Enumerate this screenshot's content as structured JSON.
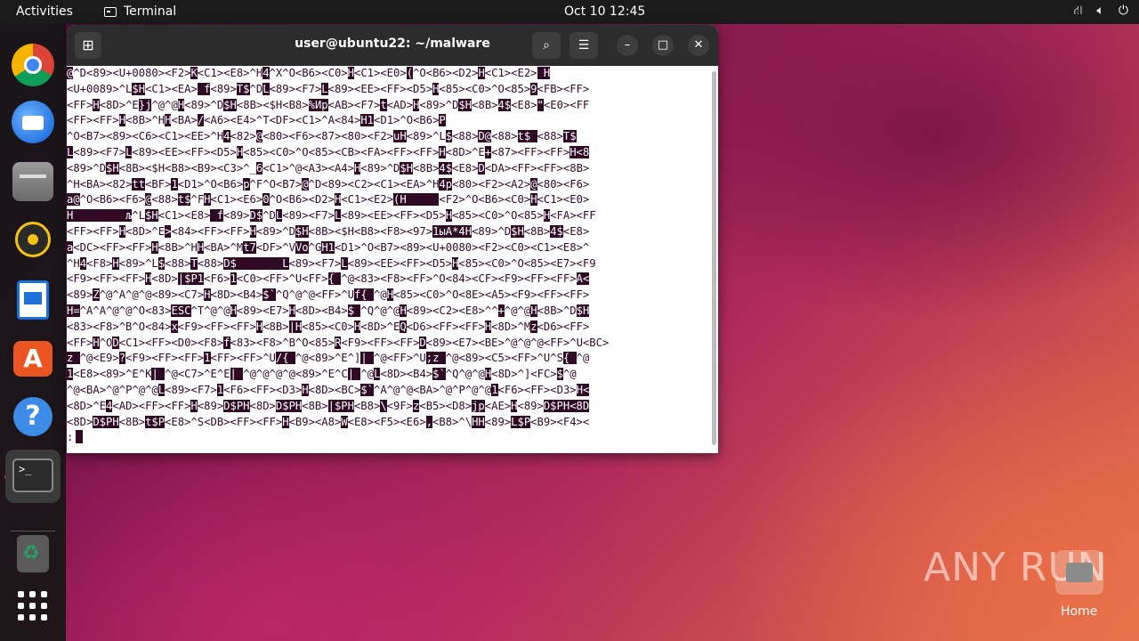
{
  "topbar": {
    "activities": "Activities",
    "task": "Terminal",
    "clock": "Oct 10  12:45",
    "tray": [
      "network-icon",
      "volume-icon",
      "power-icon"
    ]
  },
  "dock": {
    "items": [
      "chrome-icon",
      "thunderbird-icon",
      "files-icon",
      "rhythmbox-icon",
      "writer-icon",
      "app-center-icon",
      "help-icon",
      "terminal-icon",
      "trash-icon",
      "show-apps-icon"
    ],
    "terminal_glyph": ">_"
  },
  "window": {
    "title": "user@ubuntu22: ~/malware"
  },
  "terminal": {
    "lines": [
      "@^D<89><U+0080><F2>K<C1><E8>^H4^X^O<B6><C0>H<C1><E0>(^O<B6><D2>H<C1><E2> H",
      "<U+0089>^L$H<C1><EA> f<89>T$^DL<89><F7>L<89><EE><FF><D5>H<85><C0>^O<85>9<FB><FF>",
      "<FF>H<8D>^E}j^@^@H<89>^D$H<8B><$H<B8>%Иp<AB><F7>t<AD>H<89>^D$H<8B>4$<E8>\"<E0><FF",
      "<FF><FF>H<8B>^HH<BA>/<A6><E4>^T<DF><C1>^A<84>H1<D1>^O<B6>P",
      "^O<B7><89><C6><C1><EE>^H4<82>@<80><F6><87><80><F2>uH<89>^L$<88>D@<88>t$ <88>T$",
      "L<89><F7>L<89><EE><FF><D5>H<85><C0>^O<85><CB><FA><FF><FF>H<8D>^E+<87><FF><FF>H<8",
      "<89>^D$H<8B><$H<B8><B9><C3>^_6<C1>^@<A3><A4>H<89>^D$H<8B>4$<E8>D<DA><FF><FF><8B>",
      "^H<BA><82>tt<BF>1<D1>^O<B6>p^F^O<B7>@^D<89><C2><C1><EA>^H4p<80><F2><A2>@<80><F6>",
      "a@^O<B6><F6>@<88>t$^FH<C1><E6>0^O<B6><D2>H<C1><E2>(H     <F2>^O<B6><C0>H<C1><E0>",
      "H        љ^L$H<C1><E8> f<89>D$^DL<89><F7>L<89><EE><FF><D5>H<85><C0>^O<85>H<FA><FF",
      "<FF><FF>H<8D>^E><84><FF><FF>H<89>^D$H<8B><$H<B8><F8><97>1ыА*4H<89>^D$H<8B>4$<E8>",
      "a<DC><FF><FF>H<8B>^HH<BA>^Mt7<DF>^VVo^GH1<D1>^O<B7><89><U+0080><F2><C0><C1><E8>^",
      "^H4<F8>H<89>^L$<88>T<88>D$       L<89><F7>L<89><EE><FF><D5>H<85><C0>^O<85><E7><F9",
      "<F9><FF><FF>H<8D>|$P1<F6>1<C0><FF>^U<FF>{ ^@<83><F8><FF>^O<84><CF><F9><FF><FF>A<",
      "<89>Z^@^A^@^@<89><C7>H<8D><B4>$`^Q^@^@<FF>^Uf{ ^@H<85><C0>^O<8E><A5><F9><FF><FF>",
      "H=^A^A^@^@^O<83>ESC^T^@^@H<89><E7>H<8D><B4>$ ^Q^@^@H<89><C2><E8>^^+^@^@H<8B>^D$H",
      "<83><F8>^B^O<84>x<F9><FF><FF>H<8B>|H<85><C0>H<8D>^EQ<D6><FF><FF>H<8D>^Mz<D6><FF>",
      "<FF>H^OD<C1><FF><D0><F8>f<83><F8>^B^O<85>R<F9><FF><FF>D<89><E7><BE>^@^@^@<FF>^U<BC>",
      "z ^@<E9>?<F9><FF><FF>1<FF><FF>^U/{ ^@<89>^E^]| ^@<FF>^U;z ^@<89><C5><FF>^U^S{ ^@",
      "1<E8><89>^E^K| ^@<C7>^E^E| ^@^@^@^@<89>^E^C| ^@L<8D><B4>$`^Q^@^@H<8D>^]<FC>$^@",
      "^@<BA>^@^P^@^@L<89><F7>1<F6><FF><D3>H<8D><BC>$`^A^@^@<BA>^@^P^@^@1<F6><FF><D3>H<",
      "<8D>^E4<AD><FF><FF>H<89>D$PH<8D>D$PH<8B>|$PH<B8>\\<9F>z<B5><D8>jp<AE>H<89>D$PH<8D",
      "<8D>D$PH<8B>t$P<E8>^S<DB><FF><FF>H<B9><A8>W<E8><F5><E6>,<B8>^\\HH<89>L$P<B9><F4><",
      ":"
    ]
  },
  "watermark": "ANY RUN",
  "desktop": {
    "home_label": "Home"
  }
}
